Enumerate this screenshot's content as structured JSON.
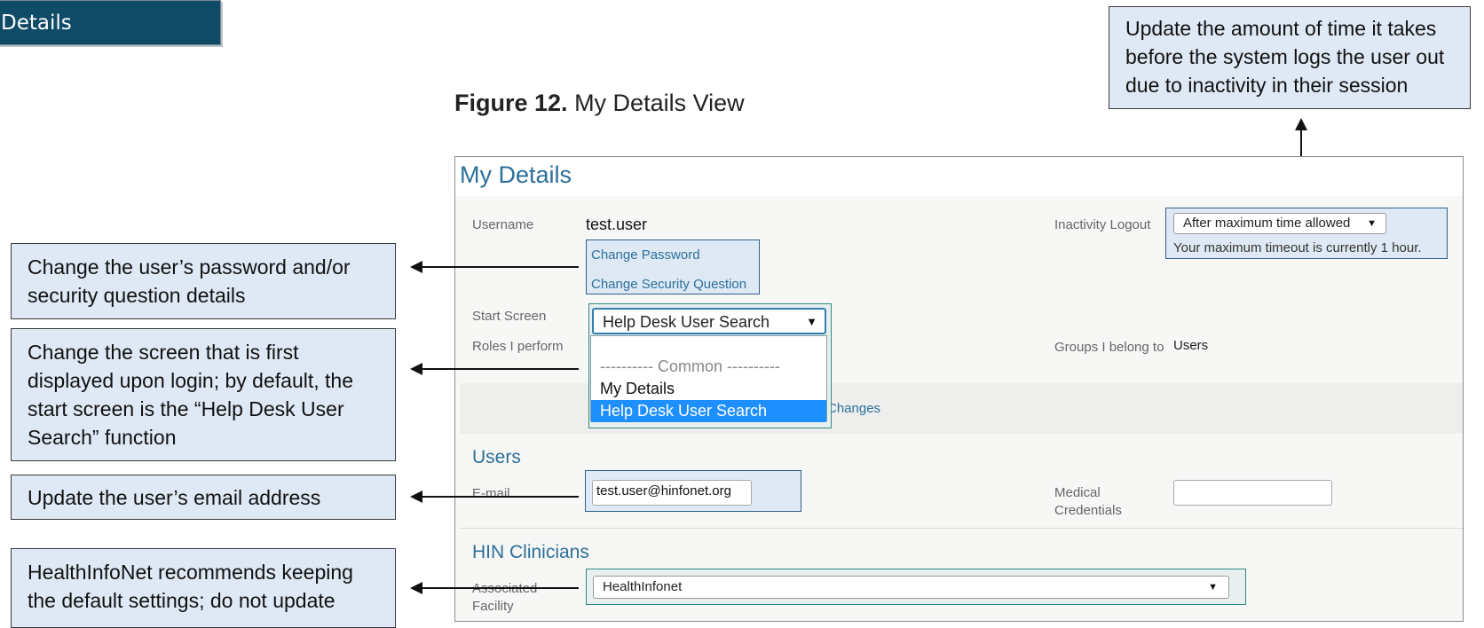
{
  "header": {
    "tab_label": "Details"
  },
  "figure": {
    "label": "Figure 12.",
    "caption": "My Details View"
  },
  "callouts": {
    "password": "Change the user’s password and/or security question details",
    "start_screen": "Change the screen that is first displayed upon login; by default, the start screen is the “Help Desk User Search” function",
    "email": "Update the user’s email address",
    "facility": "HealthInfoNet recommends keeping the default settings; do not update",
    "inactivity": "Update the amount of time it takes before the system logs the user out due to inactivity in their session"
  },
  "panel": {
    "title": "My Details",
    "username_label": "Username",
    "username_value": "test.user",
    "change_password": "Change Password",
    "change_security_question": "Change Security Question",
    "start_screen_label": "Start Screen",
    "start_screen_value": "Help Desk User Search",
    "roles_label": "Roles I perform",
    "start_screen_options": {
      "group_header": "---------- Common ----------",
      "items": [
        "My Details",
        "Help Desk User Search"
      ],
      "selected": "Help Desk User Search"
    },
    "save_changes_partial": "Changes",
    "inactivity_label": "Inactivity Logout",
    "inactivity_value": "After maximum time allowed",
    "inactivity_note": "Your maximum timeout is currently 1 hour.",
    "groups_label": "Groups I belong to",
    "groups_value": "Users"
  },
  "users_section": {
    "title": "Users",
    "email_label": "E-mail",
    "email_value": "test.user@hinfonet.org",
    "medical_credentials_label": "Medical Credentials",
    "medical_credentials_value": ""
  },
  "clinicians_section": {
    "title": "HIN Clinicians",
    "facility_label": "Associated Facility",
    "facility_value": "HealthInfonet"
  },
  "icons": {
    "dropdown": "chevron-down-icon",
    "arrow": "arrow-icon"
  }
}
